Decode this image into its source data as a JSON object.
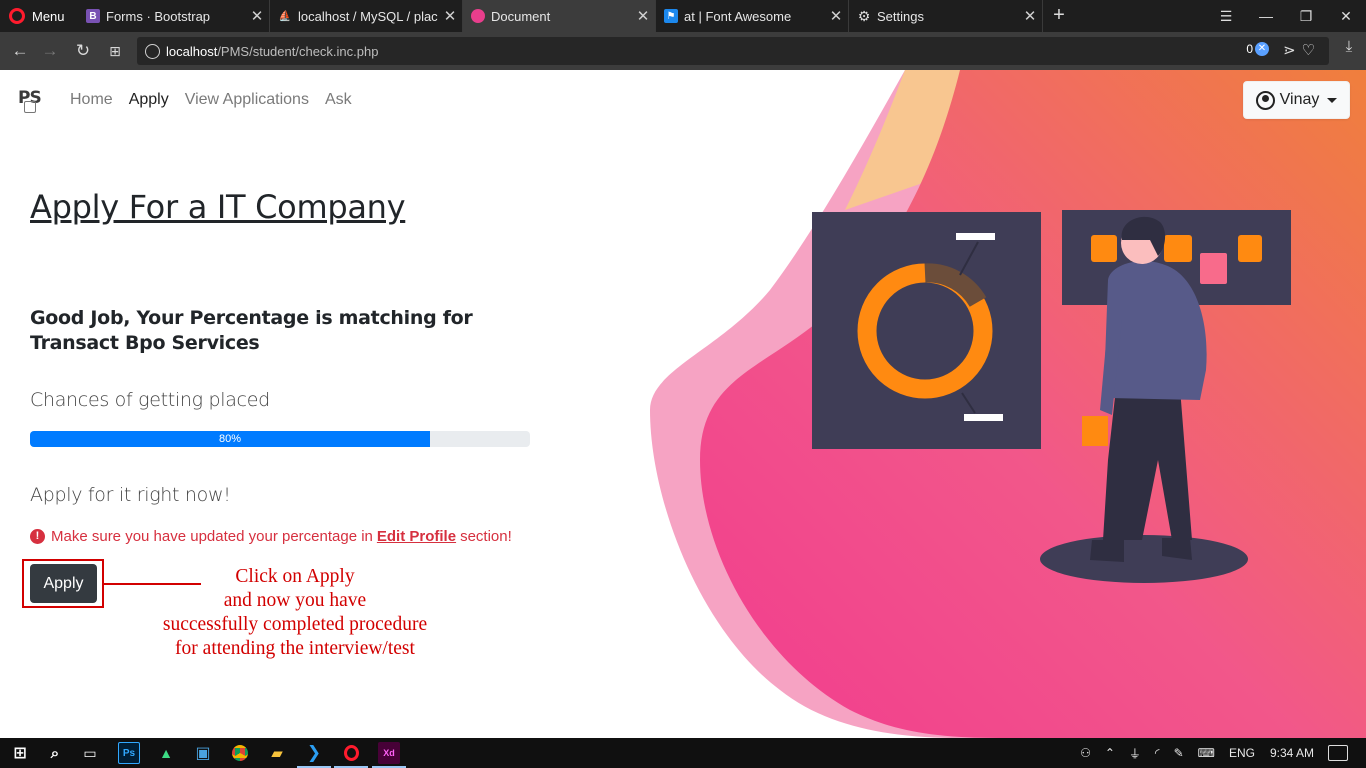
{
  "browser": {
    "menu_label": "Menu",
    "tabs": [
      {
        "label": "Forms · Bootstrap",
        "favicon": "bootstrap-icon",
        "color": "#7952b3",
        "glyph": "B"
      },
      {
        "label": "localhost / MySQL / placement",
        "favicon": "phpmyadmin-icon",
        "color": "#f29111",
        "glyph": "⛵"
      },
      {
        "label": "Document",
        "favicon": "document-icon",
        "color": "#e83e8c",
        "glyph": "●"
      },
      {
        "label": "at | Font Awesome",
        "favicon": "font-awesome-flag-icon",
        "color": "#1c88ed",
        "glyph": "⚑"
      },
      {
        "label": "Settings",
        "favicon": "gear-icon",
        "color": "#444444",
        "glyph": "⚙"
      }
    ],
    "url_host": "localhost",
    "url_path": "/PMS/student/check.inc.php",
    "adblock_count": "0"
  },
  "page": {
    "brand": "PS",
    "nav": [
      {
        "label": "Home"
      },
      {
        "label": "Apply"
      },
      {
        "label": "View Applications"
      },
      {
        "label": "Ask"
      }
    ],
    "user_name": "Vinay",
    "title": "Apply For a IT Company",
    "match_line1": "Good Job, Your Percentage is matching for",
    "company": "Transact Bpo Services",
    "chance_label": "Chances of getting placed",
    "progress_value": 80,
    "progress_label": "80%",
    "apply_now": "Apply for it right now!",
    "warning_pre": "Make sure you have updated your percentage in",
    "warning_link": "Edit Profile",
    "warning_post": "section!",
    "apply_button": "Apply",
    "callout": [
      "Click on Apply",
      "and now you have",
      "successfully completed procedure",
      "for attending the interview/test"
    ]
  },
  "taskbar": {
    "language": "ENG",
    "time": "9:34 AM",
    "apps": [
      "windows-start-icon",
      "search-icon",
      "task-view-icon",
      "photoshop-icon",
      "android-studio-icon",
      "monitor-icon",
      "chrome-icon",
      "file-explorer-icon",
      "vscode-icon",
      "opera-icon",
      "adobe-xd-icon"
    ]
  },
  "colors": {
    "accent": "#007bff",
    "alert": "#d6303f",
    "callout": "#d20000",
    "hero_orange": "#f07f3c",
    "hero_pink": "#f23c8e"
  }
}
